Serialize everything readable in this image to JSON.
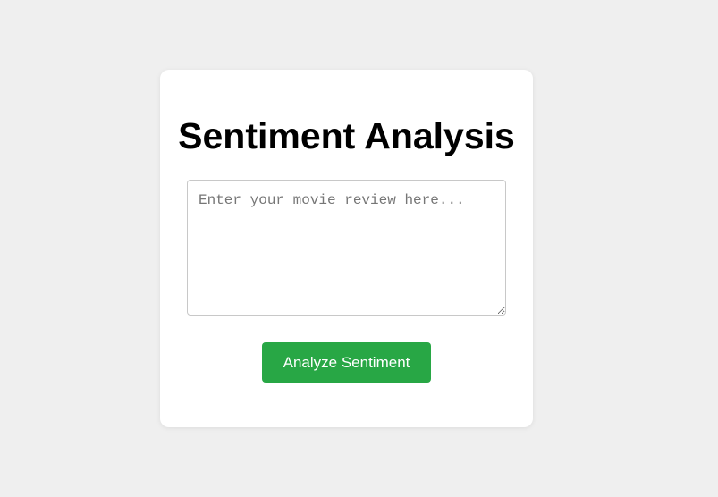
{
  "page": {
    "title": "Sentiment Analysis"
  },
  "review_input": {
    "value": "",
    "placeholder": "Enter your movie review here..."
  },
  "analyze_button": {
    "label": "Analyze Sentiment"
  },
  "colors": {
    "background": "#efefef",
    "card": "#ffffff",
    "accent": "#28a745",
    "button_text": "#ffffff"
  }
}
